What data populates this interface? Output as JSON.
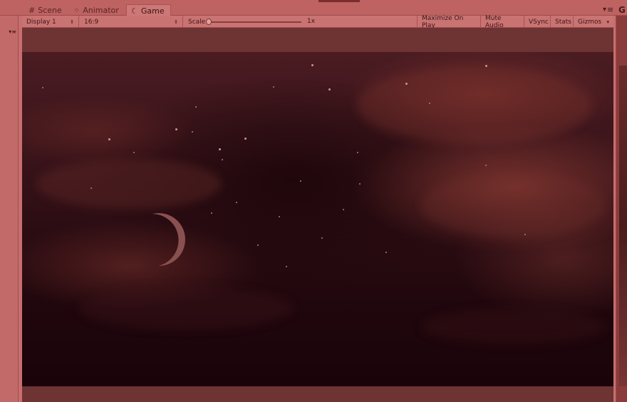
{
  "tabs": [
    {
      "label": "Scene",
      "icon": "hash-icon"
    },
    {
      "label": "Animator",
      "icon": "animator-icon"
    },
    {
      "label": "Game",
      "icon": "game-icon"
    }
  ],
  "left_panel": {
    "glyph": "▾≡"
  },
  "toolbar": {
    "display": "Display 1",
    "aspect": "16:9",
    "scale_label": "Scale",
    "scale_value": "1x",
    "scale_level": 0.0,
    "maximize": "Maximize On Play",
    "mute": "Mute Audio",
    "vsync": "VSync",
    "stats": "Stats",
    "gizmos": "Gizmos"
  },
  "colors": {
    "overlay": "#c86e6e",
    "sky_top": "#4a1c22",
    "sky_bottom": "#1a040a"
  },
  "scene": {
    "moon": "crescent-moon",
    "sky": "night-sky-with-clouds"
  }
}
